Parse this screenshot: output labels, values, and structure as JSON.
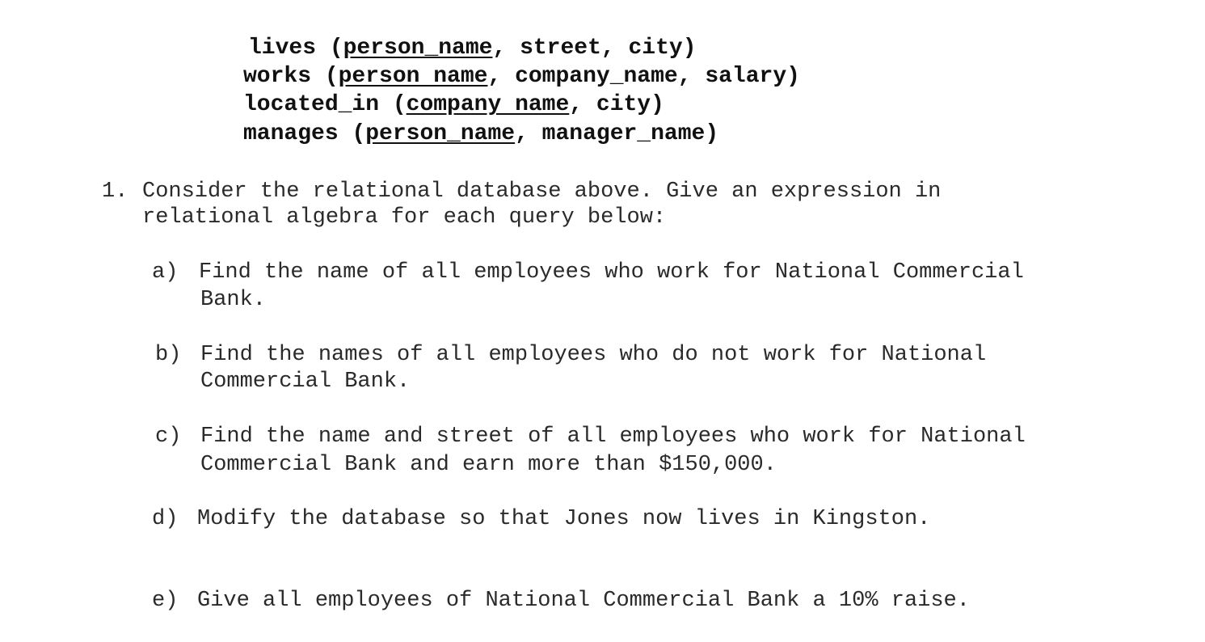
{
  "schema": [
    {
      "table": "lives",
      "open": " (",
      "key": "person_name",
      "rest": ", street, city)"
    },
    {
      "table": "works",
      "open": " (",
      "key": "person name",
      "rest": ", company_name, salary)"
    },
    {
      "table": "located_in",
      "open": " (",
      "key": "company name",
      "rest": ", city)"
    },
    {
      "table": "manages",
      "open": " (",
      "key": "person_name",
      "rest": ", manager_name)"
    }
  ],
  "question": {
    "number": "1.",
    "line1": "Consider the relational database above. Give an expression in",
    "line2": "relational algebra for each query below:"
  },
  "parts": [
    {
      "marker": "a)",
      "line1": "Find the name of all employees who work for National Commercial",
      "line2": "Bank."
    },
    {
      "marker": "b)",
      "line1": "Find the names of all employees who do not work for National",
      "line2": "Commercial Bank."
    },
    {
      "marker": "c)",
      "line1": "Find the name and street of all employees who work for National",
      "line2": "Commercial Bank and earn more than $150,000."
    },
    {
      "marker": "d)",
      "line1": "Modify the database so that Jones now lives in Kingston."
    },
    {
      "marker": "e)",
      "line1": "Give all employees of National Commercial Bank a 10% raise."
    }
  ]
}
